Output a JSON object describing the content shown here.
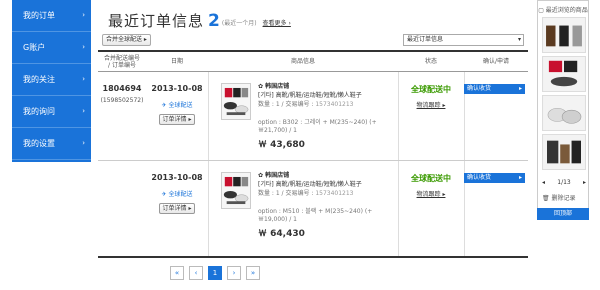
{
  "sidebar": {
    "items": [
      {
        "label": "我的订单"
      },
      {
        "label": "G账户"
      },
      {
        "label": "我的关注"
      },
      {
        "label": "我的询问"
      },
      {
        "label": "我的设置"
      }
    ],
    "chevron": "›"
  },
  "header": {
    "title": "最近订单信息",
    "count": "2",
    "range": "(最近一个月)",
    "more": "查看更多 ›"
  },
  "toolbar": {
    "merge_label": "合并全球配送 ▸",
    "order_select": "最近订单信息",
    "select_arrow": "▾"
  },
  "table": {
    "headers": {
      "order_id": "合并配送编号\n/ 订单编号",
      "date": "日期",
      "product": "商品信息",
      "status": "状态",
      "confirm": "确认/申请"
    },
    "rows": [
      {
        "merge_no": "1804694",
        "order_no": "(1598502572)",
        "date": "2013-10-08",
        "shipping": "✈ 全球配送",
        "detail_btn": "订单详情 ▸",
        "shop": "✿ 韩国店铺",
        "product_name": "[기타] 高靴/帆鞋/运动鞋/短靴/懒人鞋子",
        "qty_line": "数量 : 1 / 交易编号 : ",
        "trade_no": "1573401213",
        "option": "option : B302 : 그레이 + M(235~240) (+￦21,700) / 1",
        "price": "￦ 43,680",
        "status": "全球配送中",
        "track": "物流跟踪 ▸",
        "confirm_btn": "确认收货"
      },
      {
        "merge_no": "",
        "order_no": "",
        "date": "2013-10-08",
        "shipping": "✈ 全球配送",
        "detail_btn": "订单详情 ▸",
        "shop": "✿ 韩国店铺",
        "product_name": "[기타] 高靴/帆鞋/运动鞋/短靴/懒人鞋子",
        "qty_line": "数量 : 1 / 交易编号 : ",
        "trade_no": "1573401213",
        "option": "option : M510 : 블랙 + M(235~240) (+￦19,000) / 1",
        "price": "￦ 64,430",
        "status": "全球配送中",
        "track": "物流跟踪 ▸",
        "confirm_btn": "确认收货"
      }
    ]
  },
  "pager": {
    "first": "«",
    "prev": "‹",
    "current": "1",
    "next": "›",
    "last": "»"
  },
  "recent": {
    "title": "▢ 最近浏览的商品",
    "prev": "◂",
    "page": "1/13",
    "next": "▸",
    "clear": "🗑 删除记录",
    "back": "回顶部"
  },
  "colors": {
    "accent": "#1a73d9",
    "status_green": "#3a9a00"
  }
}
